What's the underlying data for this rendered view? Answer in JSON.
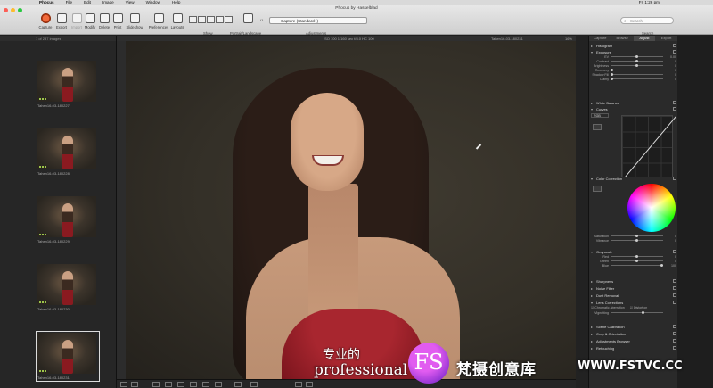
{
  "menubar": {
    "apple": "",
    "items": [
      "Phocus",
      "File",
      "Edit",
      "Image",
      "View",
      "Window",
      "Help"
    ],
    "clock": "Fri 1:26 pm"
  },
  "window": {
    "title": "Phocus by Hasselblad"
  },
  "toolbar": {
    "capture": "Capture",
    "export": "Export",
    "import": "Import",
    "modify": "Modify",
    "delete": "Delete",
    "print": "Print",
    "slideshow": "Slideshow",
    "preferences": "Preferences",
    "layouts": "Layouts",
    "show": "Show",
    "portrait_landscape": "Portrait/Landscape",
    "adjustments": "Adjustments",
    "adjustments_value": "Capture (Standard+)",
    "search": "Search",
    "search_placeholder": "Search"
  },
  "browser": {
    "header": "1 of 237 images",
    "thumbs": [
      {
        "name": "Tahen16-03-180227"
      },
      {
        "name": "Tahen16-03-180228"
      },
      {
        "name": "Tahen16-03-180229"
      },
      {
        "name": "Tahen16-03-180230"
      },
      {
        "name": "Tahen16-03-180231"
      }
    ]
  },
  "viewer": {
    "meta": "ISO 100  1/160 sec  f/8.0  HC 100",
    "filename": "Tahen16-03-180231",
    "zoom": "16%"
  },
  "panel": {
    "tabs": [
      "Capture",
      "Browse",
      "Adjust",
      "Export"
    ],
    "active_tab": "Adjust",
    "tools": {
      "histogram": "Histogram",
      "exposure": "Exposure",
      "ev": "EV",
      "ev_val": "0.00",
      "contrast": "Contrast",
      "contrast_val": "0",
      "brightness": "Brightness",
      "brightness_val": "0",
      "recovery": "Recovery",
      "recovery_val": "0",
      "shadow_fill": "Shadow Fill",
      "shadow_fill_val": "0",
      "clarity": "Clarity",
      "clarity_val": "0",
      "white_balance": "White Balance",
      "curves": "Curves",
      "curves_channel": "RGB",
      "color_correction": "Color Correction",
      "saturation": "Saturation",
      "saturation_val": "0",
      "vibrance": "Vibrance",
      "vibrance_val": "0",
      "grayscale": "Grayscale",
      "red": "Red",
      "red_val": "0",
      "green": "Green",
      "green_val": "0",
      "blue": "Blue",
      "blue_val": "100",
      "sharpness": "Sharpness",
      "noise_filter": "Noise Filter",
      "dust_removal": "Dust Removal",
      "lens_corrections": "Lens Corrections",
      "chromatic": "Chromatic aberration",
      "distortion": "Distortion",
      "vignetting": "Vignetting",
      "scene_calibration": "Scene Calibration",
      "crop_orientation": "Crop & Orientation",
      "adjustments_browser": "Adjustments Browser",
      "retouching": "Retouching"
    }
  },
  "overlay": {
    "subtitle_cn": "专业的",
    "subtitle_en": "professional",
    "watermark_logo": "FS",
    "watermark_text": "梵摄创意库",
    "watermark_url": "WWW.FSTVC.CC"
  },
  "colors": {
    "accent_capture": "#f06a3c",
    "rating_green": "#9ec64a"
  }
}
